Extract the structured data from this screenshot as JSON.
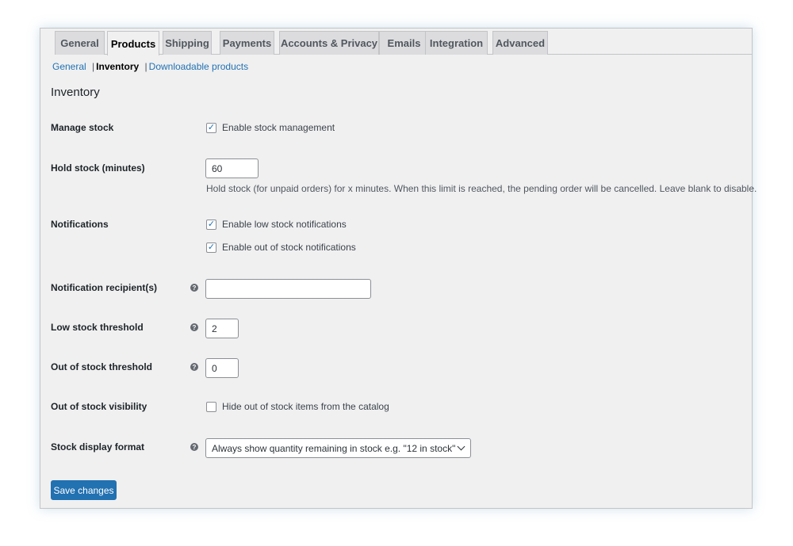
{
  "tabs": [
    {
      "label": "General"
    },
    {
      "label": "Products",
      "active": true
    },
    {
      "label": "Shipping"
    },
    {
      "label": "Payments"
    },
    {
      "label": "Accounts & Privacy"
    },
    {
      "label": "Emails"
    },
    {
      "label": "Integration"
    },
    {
      "label": "Advanced"
    }
  ],
  "subnav": {
    "general": "General",
    "separator": "|",
    "inventory": "Inventory",
    "downloadable": "Downloadable products"
  },
  "section_title": "Inventory",
  "fields": {
    "manage_stock": {
      "label": "Manage stock",
      "option": "Enable stock management",
      "checked": true
    },
    "hold_stock": {
      "label": "Hold stock (minutes)",
      "value": "60",
      "description": "Hold stock (for unpaid orders) for x minutes. When this limit is reached, the pending order will be cancelled. Leave blank to disable."
    },
    "notifications": {
      "label": "Notifications",
      "low_stock": "Enable low stock notifications",
      "out_of_stock": "Enable out of stock notifications",
      "low_checked": true,
      "out_checked": true
    },
    "recipient": {
      "label": "Notification recipient(s)",
      "value": ""
    },
    "low_threshold": {
      "label": "Low stock threshold",
      "value": "2"
    },
    "out_threshold": {
      "label": "Out of stock threshold",
      "value": "0"
    },
    "visibility": {
      "label": "Out of stock visibility",
      "option": "Hide out of stock items from the catalog",
      "checked": false
    },
    "display_format": {
      "label": "Stock display format",
      "selected": "Always show quantity remaining in stock e.g. \"12 in stock\""
    }
  },
  "help_glyph": "?",
  "check_glyph": "✓",
  "save_label": "Save changes",
  "colors": {
    "accent": "#2271b1",
    "background": "#f0f0f1"
  }
}
